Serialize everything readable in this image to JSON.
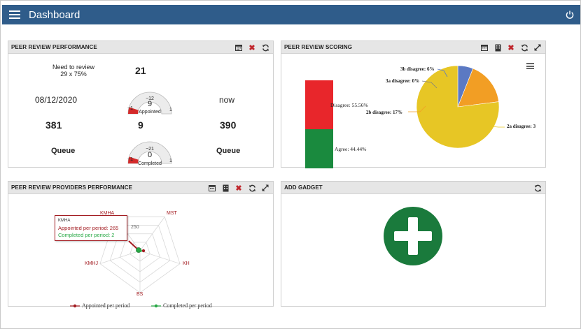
{
  "header": {
    "title": "Dashboard",
    "menu_icon": "hamburger-icon",
    "power_icon": "power-icon",
    "bg": "#2f5c8a"
  },
  "performance": {
    "title": "PEER REVIEW PERFORMANCE",
    "need_label": "Need to review",
    "need_sub": "29 x 75%",
    "need_value": "21",
    "start_date": "08/12/2020",
    "end_date": "now",
    "gauge1": {
      "min": "−1",
      "max": "1",
      "small": "−12",
      "value": "9",
      "label": "Appointed",
      "fill": 0.1
    },
    "gauge2": {
      "min": "−1",
      "max": "1",
      "small": "−21",
      "value": "0",
      "label": "Completed",
      "fill": 0.1
    },
    "left_total": "381",
    "mid_total": "9",
    "right_total": "390",
    "left_label": "Queue",
    "right_label": "Queue"
  },
  "scoring": {
    "title": "PEER REVIEW SCORING",
    "bar": {
      "disagree_label": "Disagree: 55.56%",
      "agree_label": "Agree: 44.44%",
      "disagree_pct": 55.56,
      "agree_pct": 44.44,
      "disagree_color": "#e8262b",
      "agree_color": "#1a8a3e"
    },
    "pie_labels": {
      "a3b": "3b disagree: 6%",
      "a3a": "3a disagree: 0%",
      "a2b": "2b disagree: 17%",
      "a2a": "2a disagree: 3"
    }
  },
  "chart_data": [
    {
      "type": "bar",
      "categories": [
        "Disagree",
        "Agree"
      ],
      "values": [
        55.56,
        44.44
      ]
    },
    {
      "type": "pie",
      "categories": [
        "3b disagree",
        "3a disagree",
        "2b disagree",
        "2a disagree"
      ],
      "values": [
        6,
        0,
        17,
        77
      ],
      "colors": [
        "#5b79c3",
        "#7f7f7f",
        "#f29e24",
        "#e7c625"
      ]
    },
    {
      "type": "radar",
      "axes": [
        "KMHA",
        "MST",
        "KH",
        "BS",
        "KMHJ"
      ],
      "tick": "250",
      "series": [
        {
          "name": "Appointed per period",
          "color": "#a31d22"
        },
        {
          "name": "Completed per period",
          "color": "#27a845"
        }
      ]
    }
  ],
  "providers": {
    "title": "PEER REVIEW PROVIDERS PERFORMANCE",
    "axes": {
      "kmha": "KMHA",
      "mst": "MST",
      "kh": "KH",
      "bs": "BS",
      "kmhj": "KMHJ"
    },
    "tick": "250",
    "tooltip": {
      "name": "KMHA",
      "appointed": "Appointed per period: 265",
      "completed": "Completed per period: 2"
    },
    "legend": {
      "appointed": "Appointed per period",
      "completed": "Completed per period"
    }
  },
  "gadget": {
    "title": "ADD GADGET",
    "plus_color": "#1a7a3c"
  }
}
